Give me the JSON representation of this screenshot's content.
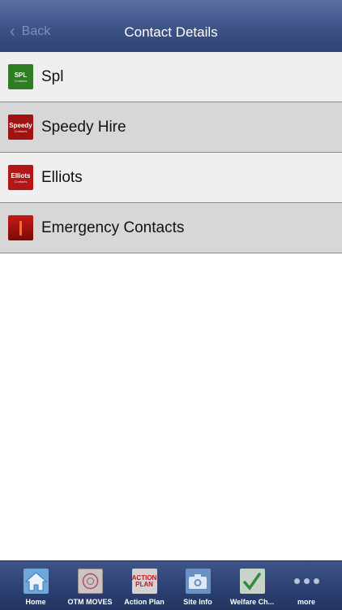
{
  "navbar": {
    "back_label": "Back",
    "title": "Contact Details"
  },
  "contacts": [
    {
      "name": "Spl",
      "thumb_text": "SPL",
      "thumb_sub": "Contacts",
      "thumb_color": "#2f7d22"
    },
    {
      "name": "Speedy Hire",
      "thumb_text": "Speedy",
      "thumb_sub": "Contacts",
      "thumb_color": "#a11212"
    },
    {
      "name": "Elliots",
      "thumb_text": "Elliots",
      "thumb_sub": "Contacts",
      "thumb_color": "#b21616"
    },
    {
      "name": "Emergency Contacts",
      "thumb_text": "",
      "thumb_sub": "",
      "thumb_color": "#c41b15"
    }
  ],
  "tabs": [
    {
      "label": "Home",
      "icon": "home-icon"
    },
    {
      "label": "OTM MOVES",
      "icon": "otm-moves-icon"
    },
    {
      "label": "Action Plan",
      "icon": "action-plan-icon",
      "icon_text": "ACTION PLAN"
    },
    {
      "label": "Site Info",
      "icon": "camera-icon"
    },
    {
      "label": "Welfare Ch...",
      "icon": "checkmark-icon"
    },
    {
      "label": "more",
      "icon": "more-icon"
    }
  ]
}
